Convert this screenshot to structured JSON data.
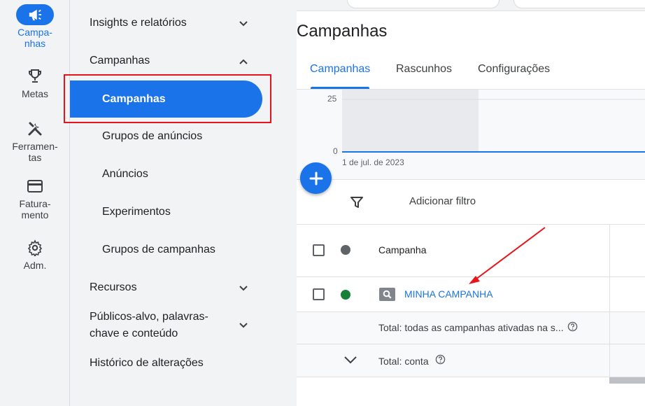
{
  "rail": {
    "items": [
      {
        "label": "Campa-\nnhas",
        "icon": "megaphone-icon",
        "active": true
      },
      {
        "label": "Metas",
        "icon": "trophy-icon"
      },
      {
        "label": "Ferramen-\ntas",
        "icon": "tools-icon"
      },
      {
        "label": "Fatura-\nmento",
        "icon": "credit-card-icon"
      },
      {
        "label": "Adm.",
        "icon": "gear-icon"
      }
    ]
  },
  "nav": {
    "insights": "Insights e relatórios",
    "campanhas_group": "Campanhas",
    "campanhas_active": "Campanhas",
    "grupos_anuncios": "Grupos de anúncios",
    "anuncios": "Anúncios",
    "experimentos": "Experimentos",
    "grupos_campanhas": "Grupos de campanhas",
    "recursos": "Recursos",
    "publicos": "Públicos-alvo, palavras-\nchave e conteúdo",
    "historico": "Histórico de alterações"
  },
  "main": {
    "title": "Campanhas",
    "tabs": [
      {
        "label": "Campanhas",
        "active": true
      },
      {
        "label": "Rascunhos"
      },
      {
        "label": "Configurações"
      }
    ],
    "chart": {
      "y_top": "25",
      "y_bottom": "0",
      "x_label": "1 de jul. de 2023"
    },
    "filter": {
      "label": "Adicionar filtro"
    },
    "table": {
      "header": "Campanha",
      "row_campaign": "MINHA CAMPANHA",
      "total_enabled": "Total: todas as campanhas ativadas na s...",
      "total_account": "Total: conta"
    }
  },
  "colors": {
    "accent": "#1a73e8",
    "highlight_border": "#e8141c",
    "status_enabled": "#188038",
    "status_header": "#5f6368"
  }
}
